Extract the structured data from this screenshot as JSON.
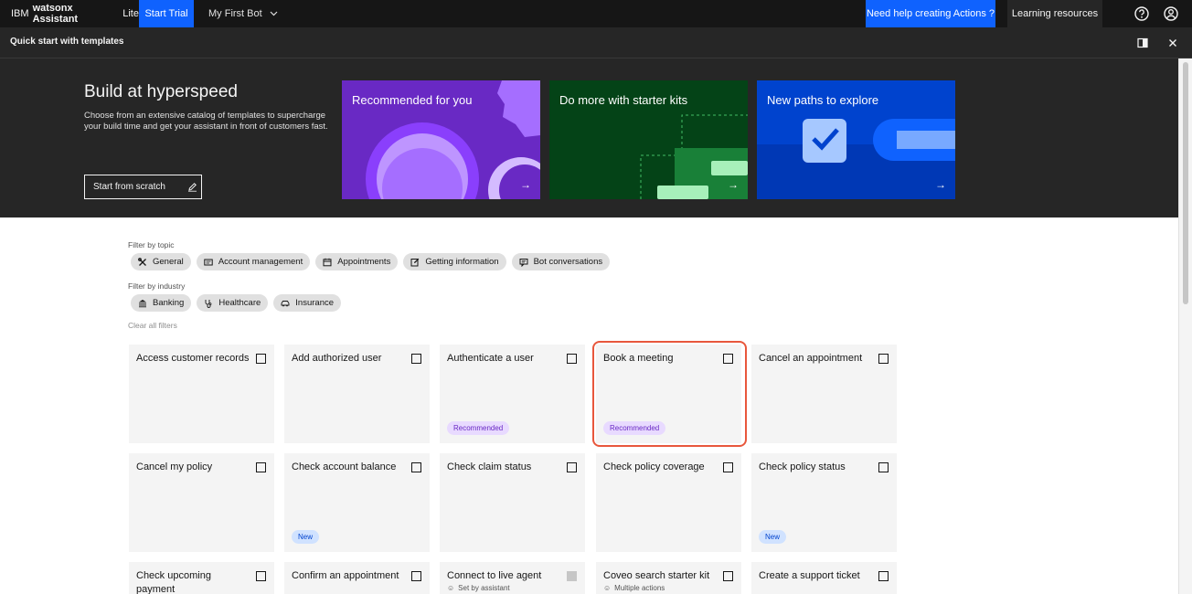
{
  "topbar": {
    "brand_prefix": "IBM",
    "brand_name": "watsonx Assistant",
    "brand_plan": "Lite",
    "start_trial": "Start Trial",
    "bot_name": "My First Bot",
    "help_actions": "Need help creating Actions ?",
    "learning": "Learning resources"
  },
  "panel": {
    "title": "Quick start with templates"
  },
  "hero": {
    "title": "Build at hyperspeed",
    "description": "Choose from an extensive catalog of templates to supercharge your build time and get your assistant in front of customers fast.",
    "scratch_button": "Start from scratch",
    "cards": [
      {
        "caption": "Recommended for you",
        "arrow": "→"
      },
      {
        "caption": "Do more with starter kits",
        "arrow": "→"
      },
      {
        "caption": "New paths to explore",
        "arrow": "→"
      }
    ]
  },
  "filters": {
    "topic_label": "Filter by topic",
    "topics": [
      "General",
      "Account management",
      "Appointments",
      "Getting information",
      "Bot conversations"
    ],
    "industry_label": "Filter by industry",
    "industries": [
      "Banking",
      "Healthcare",
      "Insurance"
    ],
    "clear_all": "Clear all filters"
  },
  "tiles": [
    {
      "name": "Access customer records",
      "tag": ""
    },
    {
      "name": "Add authorized user",
      "tag": ""
    },
    {
      "name": "Authenticate a user",
      "tag": "Recommended"
    },
    {
      "name": "Book a meeting",
      "tag": "Recommended"
    },
    {
      "name": "Cancel an appointment",
      "tag": ""
    },
    {
      "name": "Cancel my policy",
      "tag": ""
    },
    {
      "name": "Check account balance",
      "tag": "New"
    },
    {
      "name": "Check claim status",
      "tag": ""
    },
    {
      "name": "Check policy coverage",
      "tag": ""
    },
    {
      "name": "Check policy status",
      "tag": "New"
    },
    {
      "name": "Check upcoming payment",
      "tag": ""
    },
    {
      "name": "Confirm an appointment",
      "tag": ""
    },
    {
      "name": "Connect to live agent",
      "meta": "Set by assistant"
    },
    {
      "name": "Coveo search starter kit",
      "meta": "Multiple actions"
    },
    {
      "name": "Create a support ticket",
      "tag": ""
    }
  ]
}
